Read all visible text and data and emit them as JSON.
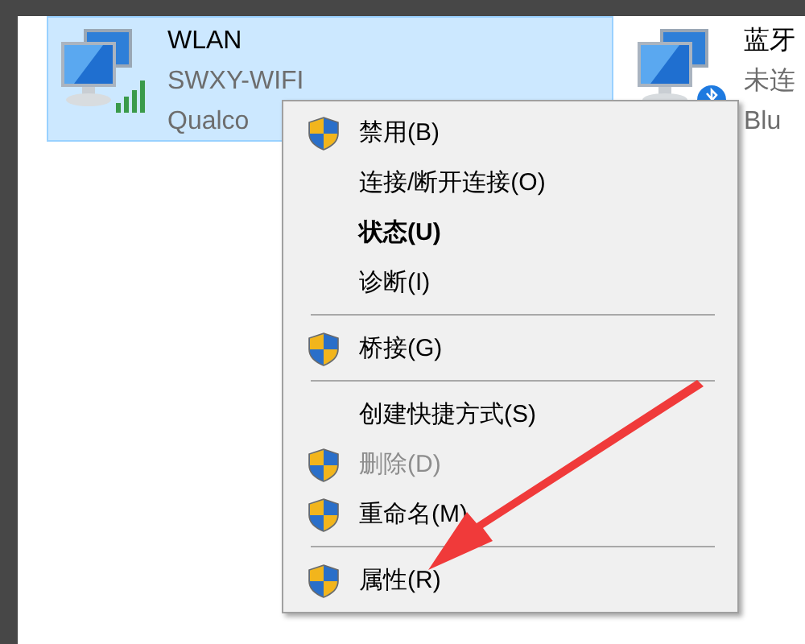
{
  "adapters": [
    {
      "title": "WLAN",
      "status": "SWXY-WIFI",
      "device": "Qualco",
      "selected": true,
      "kind": "wifi"
    },
    {
      "title": "蓝牙",
      "status": "未连",
      "device": "Blu",
      "selected": false,
      "kind": "bluetooth"
    }
  ],
  "context_menu": [
    {
      "kind": "item",
      "label": "禁用(B)",
      "shield": true,
      "disabled": false,
      "bold": false
    },
    {
      "kind": "item",
      "label": "连接/断开连接(O)",
      "shield": false,
      "disabled": false,
      "bold": false
    },
    {
      "kind": "item",
      "label": "状态(U)",
      "shield": false,
      "disabled": false,
      "bold": true
    },
    {
      "kind": "item",
      "label": "诊断(I)",
      "shield": false,
      "disabled": false,
      "bold": false
    },
    {
      "kind": "separator"
    },
    {
      "kind": "item",
      "label": "桥接(G)",
      "shield": true,
      "disabled": false,
      "bold": false
    },
    {
      "kind": "separator"
    },
    {
      "kind": "item",
      "label": "创建快捷方式(S)",
      "shield": false,
      "disabled": false,
      "bold": false
    },
    {
      "kind": "item",
      "label": "删除(D)",
      "shield": true,
      "disabled": true,
      "bold": false
    },
    {
      "kind": "item",
      "label": "重命名(M)",
      "shield": true,
      "disabled": false,
      "bold": false
    },
    {
      "kind": "separator"
    },
    {
      "kind": "item",
      "label": "属性(R)",
      "shield": true,
      "disabled": false,
      "bold": false
    }
  ]
}
